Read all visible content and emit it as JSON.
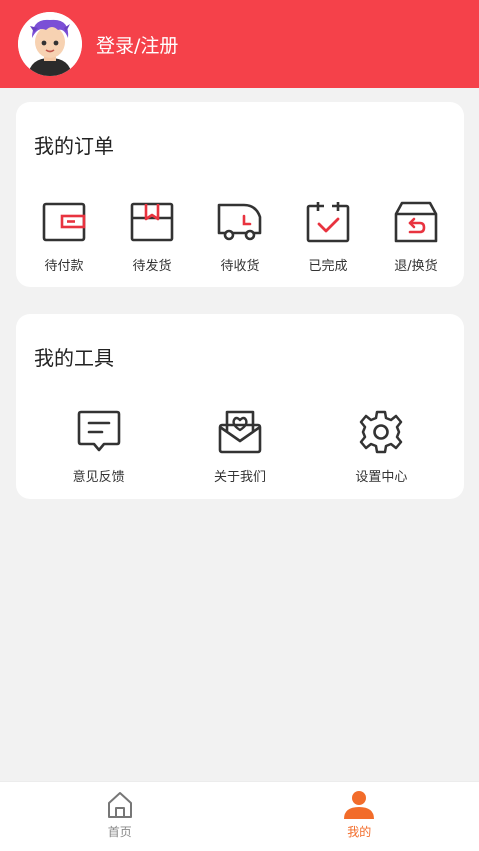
{
  "header": {
    "login_label": "登录/注册"
  },
  "orders": {
    "title": "我的订单",
    "items": [
      {
        "label": "待付款",
        "icon": "wallet-icon"
      },
      {
        "label": "待发货",
        "icon": "package-icon"
      },
      {
        "label": "待收货",
        "icon": "delivery-truck-icon"
      },
      {
        "label": "已完成",
        "icon": "calendar-check-icon"
      },
      {
        "label": "退/换货",
        "icon": "return-box-icon"
      }
    ]
  },
  "tools": {
    "title": "我的工具",
    "items": [
      {
        "label": "意见反馈",
        "icon": "feedback-message-icon"
      },
      {
        "label": "关于我们",
        "icon": "heart-envelope-icon"
      },
      {
        "label": "设置中心",
        "icon": "gear-icon"
      }
    ]
  },
  "tabbar": {
    "items": [
      {
        "label": "首页",
        "icon": "home-icon",
        "active": false
      },
      {
        "label": "我的",
        "icon": "user-icon",
        "active": true
      }
    ]
  },
  "colors": {
    "brand": "#f5414a",
    "accent": "#f26c2a",
    "icon_stroke": "#333333",
    "icon_highlight": "#e8333f"
  }
}
